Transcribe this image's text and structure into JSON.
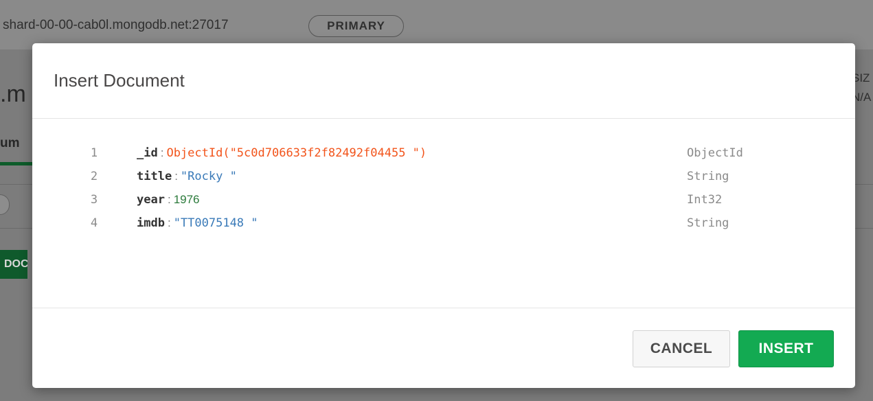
{
  "background": {
    "host": "shard-00-00-cab0l.mongodb.net:27017",
    "badge": "PRIMARY",
    "title_fragment": ".m",
    "tab_fragment": "um",
    "button_fragment": "DOC",
    "right_fragment_1": "SIZ",
    "right_fragment_2": "N/A"
  },
  "modal": {
    "title": "Insert Document",
    "fields": [
      {
        "line": "1",
        "key": "_id",
        "sep": ":",
        "value": "ObjectId(\"5c0d706633f2f82492f04455 \")",
        "kind": "oid",
        "type": "ObjectId"
      },
      {
        "line": "2",
        "key": "title",
        "sep": ":",
        "value": "\"Rocky \"",
        "kind": "str",
        "type": "String"
      },
      {
        "line": "3",
        "key": "year",
        "sep": ":",
        "value": "1976",
        "kind": "num",
        "type": "Int32"
      },
      {
        "line": "4",
        "key": "imdb",
        "sep": ":",
        "value": "\"TT0075148 \"",
        "kind": "str",
        "type": "String"
      }
    ],
    "cancel_label": "CANCEL",
    "insert_label": "INSERT"
  },
  "colors": {
    "insert_button": "#13aa52",
    "objectid_value": "#f2541b",
    "string_value": "#3a7ab8",
    "number_value": "#2b7a3b"
  }
}
